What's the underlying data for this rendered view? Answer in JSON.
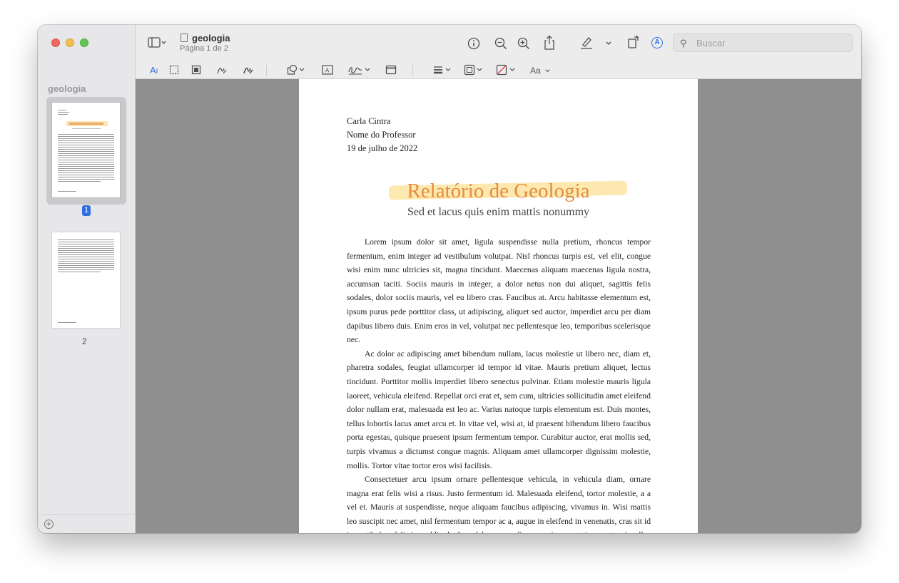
{
  "sidebar": {
    "title": "geologia",
    "pages": [
      {
        "number": "1",
        "selected": true
      },
      {
        "number": "2",
        "selected": false
      }
    ]
  },
  "toolbar": {
    "doc_title": "geologia",
    "page_info": "Página 1 de 2",
    "search_placeholder": "Buscar",
    "font_menu_label": "Aa"
  },
  "document": {
    "author": "Carla Cintra",
    "professor": "Nome do Professor",
    "date": "19 de julho de 2022",
    "title": "Relatório de Geologia",
    "subtitle": "Sed et lacus quis enim mattis nonummy",
    "paragraphs": [
      "Lorem ipsum dolor sit amet, ligula suspendisse nulla pretium, rhoncus tempor fermentum, enim integer ad vestibulum volutpat. Nisl rhoncus turpis est, vel elit, congue wisi enim nunc ultricies sit, magna tincidunt. Maecenas aliquam maecenas ligula nostra, accumsan taciti. Sociis mauris in integer, a dolor netus non dui aliquet, sagittis felis sodales, dolor sociis mauris, vel eu libero cras. Faucibus at. Arcu habitasse elementum est, ipsum purus pede porttitor class, ut adipiscing, aliquet sed auctor, imperdiet arcu per diam dapibus libero duis. Enim eros in vel, volutpat nec pellentesque leo, temporibus scelerisque nec.",
      "Ac dolor ac adipiscing amet bibendum nullam, lacus molestie ut libero nec, diam et, pharetra sodales, feugiat ullamcorper id tempor id vitae. Mauris pretium aliquet, lectus tincidunt. Porttitor mollis imperdiet libero senectus pulvinar. Etiam molestie mauris ligula laoreet, vehicula eleifend. Repellat orci erat et, sem cum, ultricies sollicitudin amet eleifend dolor nullam erat, malesuada est leo ac. Varius natoque turpis elementum est. Duis montes, tellus lobortis lacus amet arcu et. In vitae vel, wisi at, id praesent bibendum libero faucibus porta egestas, quisque praesent ipsum fermentum tempor. Curabitur auctor, erat mollis sed, turpis vivamus a dictumst congue magnis. Aliquam amet ullamcorper dignissim molestie, mollis. Tortor vitae tortor eros wisi facilisis.",
      "Consectetuer arcu ipsum ornare pellentesque vehicula, in vehicula diam, ornare magna erat felis wisi a risus. Justo fermentum id. Malesuada eleifend, tortor molestie, a a vel et. Mauris at suspendisse, neque aliquam faucibus adipiscing, vivamus in. Wisi mattis leo suscipit nec amet, nisl fermentum tempor ac a, augue in eleifend in venenatis, cras sit id in vestibulum felis in, sed ligula. In sodales suspendisse mauris quam etiam erat, quia tellus convallis eros"
    ]
  },
  "colors": {
    "accent": "#2f6ee4",
    "heading": "#e58c3c",
    "highlight": "#fde39c"
  }
}
